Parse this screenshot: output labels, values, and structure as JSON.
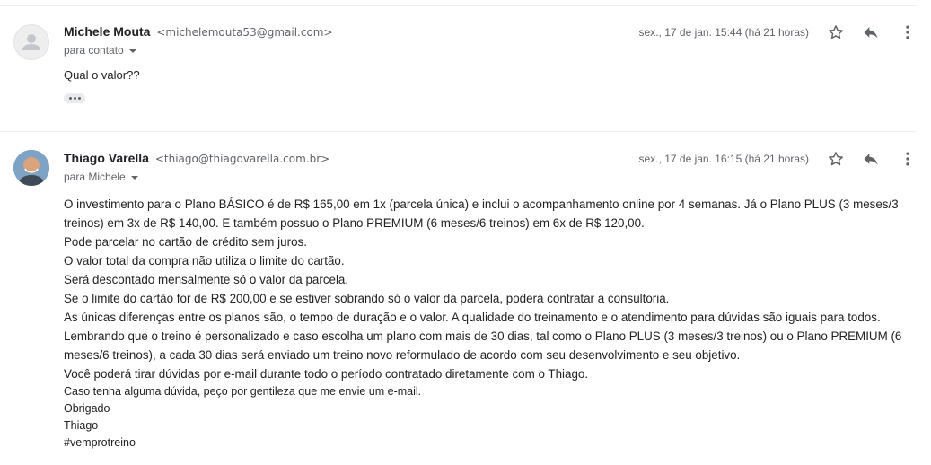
{
  "messages": [
    {
      "sender_name": "Michele Mouta",
      "sender_email": "<michelemouta53@gmail.com>",
      "recipient": "para contato",
      "date": "sex., 17 de jan. 15:44 (há 21 horas)",
      "body": "Qual o valor??"
    },
    {
      "sender_name": "Thiago Varella",
      "sender_email": "<thiago@thiagovarella.com.br>",
      "recipient": "para Michele",
      "date": "sex., 17 de jan. 16:15 (há 21 horas)",
      "body_paragraphs": [
        "O investimento para o Plano BÁSICO é de R$ 165,00 em 1x (parcela única) e inclui o acompanhamento online por 4 semanas. Já o Plano PLUS (3 meses/3 treinos) em 3x de R$ 140,00. E também possuo o Plano PREMIUM (6 meses/6 treinos) em 6x de R$ 120,00.",
        "Pode parcelar no cartão de crédito sem juros.",
        "O valor total da compra não utiliza o limite do cartão.",
        "Será descontado mensalmente só o valor da parcela.",
        "Se o limite do cartão for de R$ 200,00 e se estiver sobrando só o valor da parcela, poderá contratar a consultoria.",
        "As únicas diferenças entre os planos são, o tempo de duração e o valor. A qualidade do treinamento e o atendimento para dúvidas são iguais para todos. Lembrando que o treino é personalizado e caso escolha um plano com mais de 30 dias, tal como o Plano PLUS (3 meses/3 treinos) ou o Plano PREMIUM (6 meses/6 treinos), a cada 30 dias será enviado um treino novo reformulado de acordo com seu desenvolvimento e seu objetivo.",
        "Você poderá tirar dúvidas por e-mail durante todo o período contratado diretamente com o Thiago."
      ],
      "signature_lines": [
        "Caso tenha alguma dúvida, peço por gentileza que me envie um e-mail.",
        "Obrigado",
        "Thiago",
        "#vemprotreino"
      ]
    }
  ],
  "icons": {
    "star": "star-icon",
    "reply": "reply-icon",
    "more": "more-vert-icon",
    "avatar_default": "person-icon",
    "show_trimmed": "ellipsis-icon"
  },
  "colors": {
    "text": "#222222",
    "secondary": "#5f6368",
    "divider": "#eceff1"
  }
}
